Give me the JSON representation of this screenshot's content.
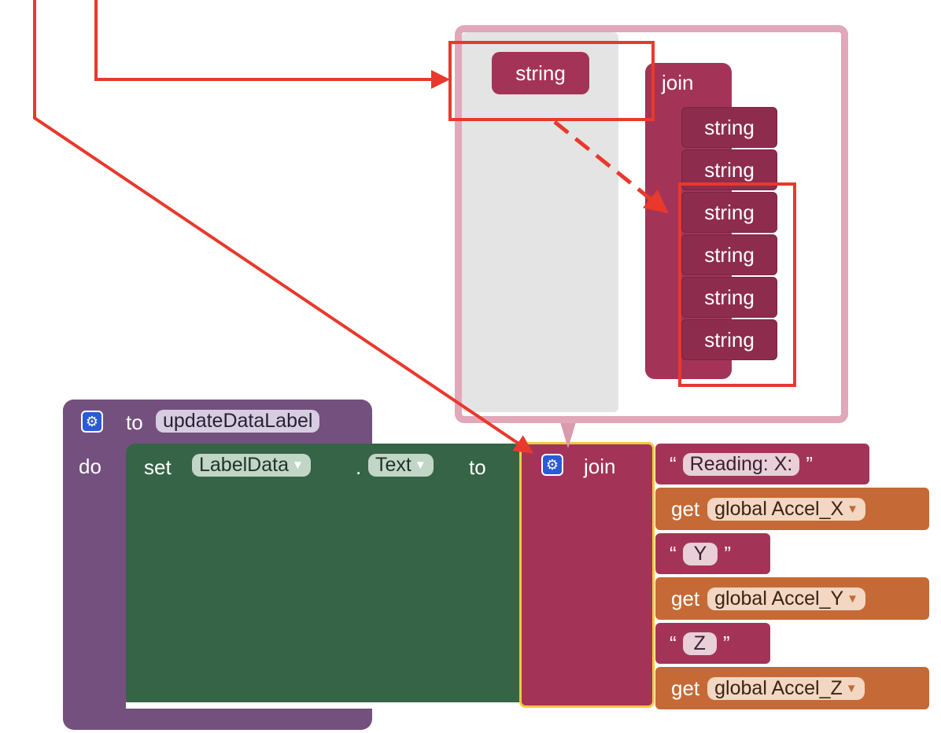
{
  "mutator": {
    "palette_block_label": "string",
    "join_label": "join",
    "item_labels": [
      "string",
      "string",
      "string",
      "string",
      "string",
      "string"
    ]
  },
  "procedure": {
    "to_label": "to",
    "name": "updateDataLabel",
    "do_label": "do"
  },
  "set_block": {
    "set_label": "set",
    "component": "LabelData",
    "dot": ".",
    "property": "Text",
    "to_label": "to"
  },
  "join_block": {
    "label": "join",
    "items": [
      {
        "kind": "text",
        "open_quote": "“",
        "value": "Reading: X:",
        "close_quote": "”"
      },
      {
        "kind": "get",
        "get_label": "get",
        "variable": "global Accel_X"
      },
      {
        "kind": "text",
        "open_quote": "“",
        "value": "Y",
        "close_quote": "”"
      },
      {
        "kind": "get",
        "get_label": "get",
        "variable": "global Accel_Y"
      },
      {
        "kind": "text",
        "open_quote": "“",
        "value": "Z",
        "close_quote": "”"
      },
      {
        "kind": "get",
        "get_label": "get",
        "variable": "global Accel_Z"
      }
    ]
  },
  "icons": {
    "gear": "gear-icon",
    "dropdown": "dropdown-arrow-icon"
  },
  "colors": {
    "procedure": "#74507e",
    "set": "#356446",
    "join": "#a33458",
    "text": "#a33458",
    "get": "#c56a36",
    "annotation": "#e8392c",
    "mutator_border": "#d99aae",
    "gear": "#2a5bd6"
  }
}
